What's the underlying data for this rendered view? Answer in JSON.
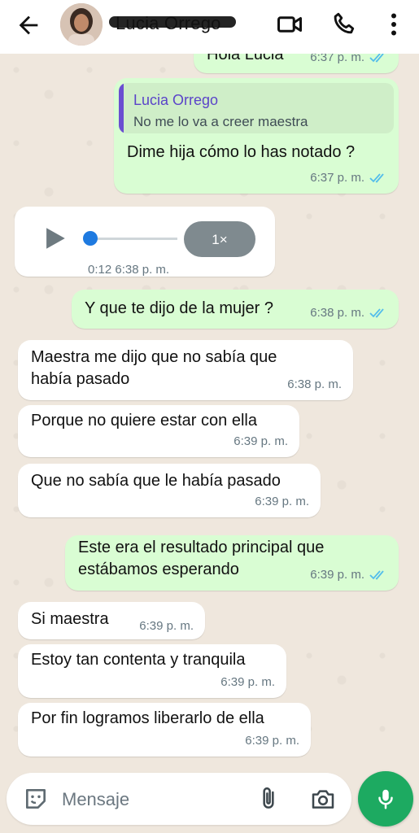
{
  "header": {
    "contact_name": "Lucia Orrego",
    "icons": [
      "back-arrow-icon",
      "video-call-icon",
      "voice-call-icon",
      "more-options-icon"
    ]
  },
  "messages": [
    {
      "dir": "out",
      "text": "Hola Lucia",
      "time": "6:37 p. m.",
      "read": true
    },
    {
      "dir": "out",
      "quote": {
        "name": "Lucia Orrego",
        "text": "No me lo va a creer maestra"
      },
      "text": "Dime hija cómo lo has notado ?",
      "time": "6:37 p. m.",
      "read": true
    },
    {
      "dir": "in",
      "type": "audio",
      "duration": "0:12",
      "time": "6:38 p. m.",
      "speed": "1×",
      "progress": 0
    },
    {
      "dir": "out",
      "text": "Y que te dijo de la mujer ?",
      "time": "6:38 p. m.",
      "read": true
    },
    {
      "dir": "in",
      "text": "Maestra me dijo que no sabía que\nhabía pasado",
      "time": "6:38 p. m."
    },
    {
      "dir": "in",
      "text": "Porque no quiere estar con ella",
      "time": "6:39 p. m."
    },
    {
      "dir": "in",
      "text": "Que no sabía que le había pasado",
      "time": "6:39 p. m."
    },
    {
      "dir": "out",
      "text": "Este era el resultado principal que\nestábamos esperando",
      "time": "6:39 p. m.",
      "read": true
    },
    {
      "dir": "in",
      "text": "Si maestra",
      "time": "6:39 p. m."
    },
    {
      "dir": "in",
      "text": "Estoy tan contenta y tranquila",
      "time": "6:39 p. m."
    },
    {
      "dir": "in",
      "text": "Por fin logramos liberarlo de ella",
      "time": "6:39 p. m."
    }
  ],
  "composer": {
    "placeholder": "Mensaje",
    "icons": [
      "emoji-icon",
      "attach-icon",
      "camera-icon",
      "mic-icon"
    ]
  },
  "colors": {
    "outgoing": "#d9fdd3",
    "incoming": "#ffffff",
    "accent": "#1daa61",
    "read_ticks": "#53bdeb"
  }
}
